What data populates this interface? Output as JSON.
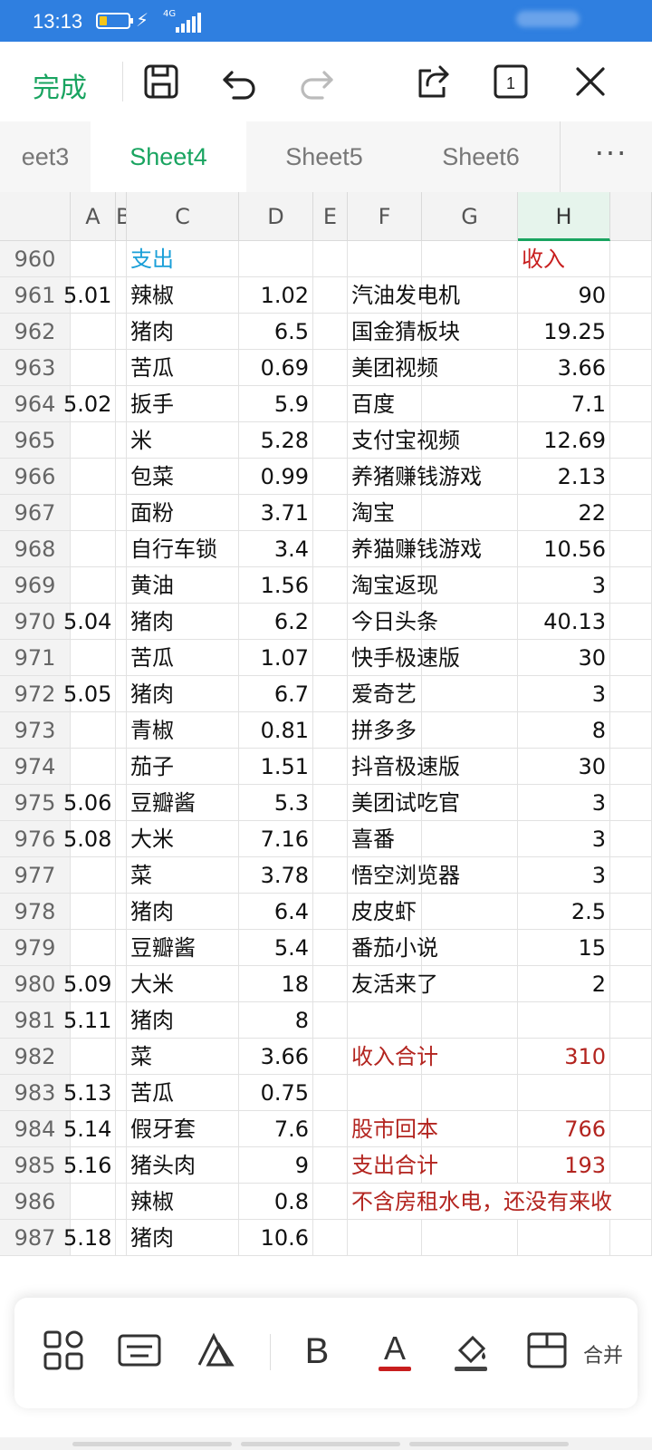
{
  "status": {
    "time": "13:13",
    "network": "4G"
  },
  "toolbar": {
    "done_label": "完成",
    "page_count": "1"
  },
  "tabs": [
    {
      "label": "eet3",
      "active": false
    },
    {
      "label": "Sheet4",
      "active": true
    },
    {
      "label": "Sheet5",
      "active": false
    },
    {
      "label": "Sheet6",
      "active": false
    }
  ],
  "tabs_more": "···",
  "columns": [
    "A",
    "B",
    "C",
    "D",
    "E",
    "F",
    "G",
    "H"
  ],
  "rows": [
    {
      "n": "960",
      "a": "",
      "c": "支出",
      "d": "",
      "f": "",
      "h": "收入"
    },
    {
      "n": "961",
      "a": "5.01",
      "c": "辣椒",
      "d": "1.02",
      "f": "汽油发电机",
      "h": "90"
    },
    {
      "n": "962",
      "a": "",
      "c": "猪肉",
      "d": "6.5",
      "f": "国金猜板块",
      "h": "19.25"
    },
    {
      "n": "963",
      "a": "",
      "c": "苦瓜",
      "d": "0.69",
      "f": "美团视频",
      "h": "3.66"
    },
    {
      "n": "964",
      "a": "5.02",
      "c": "扳手",
      "d": "5.9",
      "f": "百度",
      "h": "7.1"
    },
    {
      "n": "965",
      "a": "",
      "c": "米",
      "d": "5.28",
      "f": "支付宝视频",
      "h": "12.69"
    },
    {
      "n": "966",
      "a": "",
      "c": "包菜",
      "d": "0.99",
      "f": "养猪赚钱游戏",
      "h": "2.13"
    },
    {
      "n": "967",
      "a": "",
      "c": "面粉",
      "d": "3.71",
      "f": "淘宝",
      "h": "22"
    },
    {
      "n": "968",
      "a": "",
      "c": "自行车锁",
      "d": "3.4",
      "f": "养猫赚钱游戏",
      "h": "10.56"
    },
    {
      "n": "969",
      "a": "",
      "c": "黄油",
      "d": "1.56",
      "f": "淘宝返现",
      "h": "3"
    },
    {
      "n": "970",
      "a": "5.04",
      "c": "猪肉",
      "d": "6.2",
      "f": "今日头条",
      "h": "40.13"
    },
    {
      "n": "971",
      "a": "",
      "c": "苦瓜",
      "d": "1.07",
      "f": "快手极速版",
      "h": "30"
    },
    {
      "n": "972",
      "a": "5.05",
      "c": "猪肉",
      "d": "6.7",
      "f": "爱奇艺",
      "h": "3"
    },
    {
      "n": "973",
      "a": "",
      "c": "青椒",
      "d": "0.81",
      "f": "拼多多",
      "h": "8"
    },
    {
      "n": "974",
      "a": "",
      "c": "茄子",
      "d": "1.51",
      "f": "抖音极速版",
      "h": "30"
    },
    {
      "n": "975",
      "a": "5.06",
      "c": "豆瓣酱",
      "d": "5.3",
      "f": "美团试吃官",
      "h": "3"
    },
    {
      "n": "976",
      "a": "5.08",
      "c": "大米",
      "d": "7.16",
      "f": "喜番",
      "h": "3"
    },
    {
      "n": "977",
      "a": "",
      "c": "菜",
      "d": "3.78",
      "f": "悟空浏览器",
      "h": "3"
    },
    {
      "n": "978",
      "a": "",
      "c": "猪肉",
      "d": "6.4",
      "f": "皮皮虾",
      "h": "2.5"
    },
    {
      "n": "979",
      "a": "",
      "c": "豆瓣酱",
      "d": "5.4",
      "f": "番茄小说",
      "h": "15"
    },
    {
      "n": "980",
      "a": "5.09",
      "c": "大米",
      "d": "18",
      "f": "友活来了",
      "h": "2"
    },
    {
      "n": "981",
      "a": "5.11",
      "c": "猪肉",
      "d": "8",
      "f": "",
      "h": ""
    },
    {
      "n": "982",
      "a": "",
      "c": "菜",
      "d": "3.66",
      "f": "收入合计",
      "h": "310"
    },
    {
      "n": "983",
      "a": "5.13",
      "c": "苦瓜",
      "d": "0.75",
      "f": "",
      "h": ""
    },
    {
      "n": "984",
      "a": "5.14",
      "c": "假牙套",
      "d": "7.6",
      "f": "股市回本",
      "h": "766"
    },
    {
      "n": "985",
      "a": "5.16",
      "c": "猪头肉",
      "d": "9",
      "f": "支出合计",
      "h": "193"
    },
    {
      "n": "986",
      "a": "",
      "c": "辣椒",
      "d": "0.8",
      "f": "不含房租水电，还没有来收",
      "h": ""
    },
    {
      "n": "987",
      "a": "5.18",
      "c": "猪肉",
      "d": "10.6",
      "f": "",
      "h": ""
    }
  ],
  "bottom_toolbar": {
    "merge_label": "合并"
  },
  "colors": {
    "accent_green": "#19a460",
    "status_blue": "#2f7fe0",
    "header_blue": "#1a9fd8",
    "red": "#c81e1e"
  }
}
